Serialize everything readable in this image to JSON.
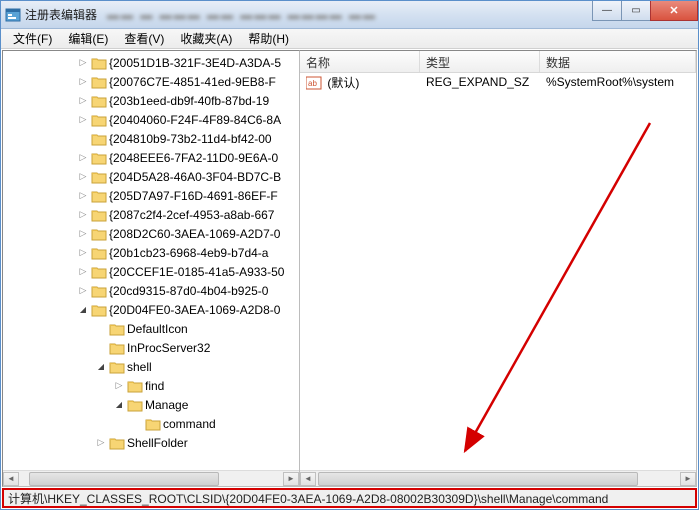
{
  "window": {
    "title": "注册表编辑器"
  },
  "menu": {
    "file": "文件(F)",
    "edit": "编辑(E)",
    "view": "查看(V)",
    "favorites": "收藏夹(A)",
    "help": "帮助(H)"
  },
  "winbuttons": {
    "min": "—",
    "max": "▭",
    "close": "✕"
  },
  "tree": {
    "nodes": [
      {
        "indent": 4,
        "exp": "closed",
        "label": "{20051D1B-321F-3E4D-A3DA-5"
      },
      {
        "indent": 4,
        "exp": "closed",
        "label": "{20076C7E-4851-41ed-9EB8-F"
      },
      {
        "indent": 4,
        "exp": "closed",
        "label": "{203b1eed-db9f-40fb-87bd-19"
      },
      {
        "indent": 4,
        "exp": "closed",
        "label": "{20404060-F24F-4F89-84C6-8A"
      },
      {
        "indent": 4,
        "exp": "none",
        "label": "{204810b9-73b2-11d4-bf42-00"
      },
      {
        "indent": 4,
        "exp": "closed",
        "label": "{2048EEE6-7FA2-11D0-9E6A-0"
      },
      {
        "indent": 4,
        "exp": "closed",
        "label": "{204D5A28-46A0-3F04-BD7C-B"
      },
      {
        "indent": 4,
        "exp": "closed",
        "label": "{205D7A97-F16D-4691-86EF-F"
      },
      {
        "indent": 4,
        "exp": "closed",
        "label": "{2087c2f4-2cef-4953-a8ab-667"
      },
      {
        "indent": 4,
        "exp": "closed",
        "label": "{208D2C60-3AEA-1069-A2D7-0"
      },
      {
        "indent": 4,
        "exp": "closed",
        "label": "{20b1cb23-6968-4eb9-b7d4-a"
      },
      {
        "indent": 4,
        "exp": "closed",
        "label": "{20CCEF1E-0185-41a5-A933-50"
      },
      {
        "indent": 4,
        "exp": "closed",
        "label": "{20cd9315-87d0-4b04-b925-0"
      },
      {
        "indent": 4,
        "exp": "open",
        "label": "{20D04FE0-3AEA-1069-A2D8-0"
      },
      {
        "indent": 5,
        "exp": "none",
        "label": "DefaultIcon"
      },
      {
        "indent": 5,
        "exp": "none",
        "label": "InProcServer32"
      },
      {
        "indent": 5,
        "exp": "open",
        "label": "shell"
      },
      {
        "indent": 6,
        "exp": "closed",
        "label": "find"
      },
      {
        "indent": 6,
        "exp": "open",
        "label": "Manage"
      },
      {
        "indent": 7,
        "exp": "none",
        "label": "command"
      },
      {
        "indent": 5,
        "exp": "closed",
        "label": "ShellFolder"
      }
    ]
  },
  "list": {
    "columns": {
      "name": "名称",
      "type": "类型",
      "data": "数据"
    },
    "rows": [
      {
        "name": "(默认)",
        "type": "REG_EXPAND_SZ",
        "data": "%SystemRoot%\\system"
      }
    ]
  },
  "statusbar": {
    "path": "计算机\\HKEY_CLASSES_ROOT\\CLSID\\{20D04FE0-3AEA-1069-A2D8-08002B30309D}\\shell\\Manage\\command"
  },
  "colors": {
    "accent": "#d40000"
  }
}
